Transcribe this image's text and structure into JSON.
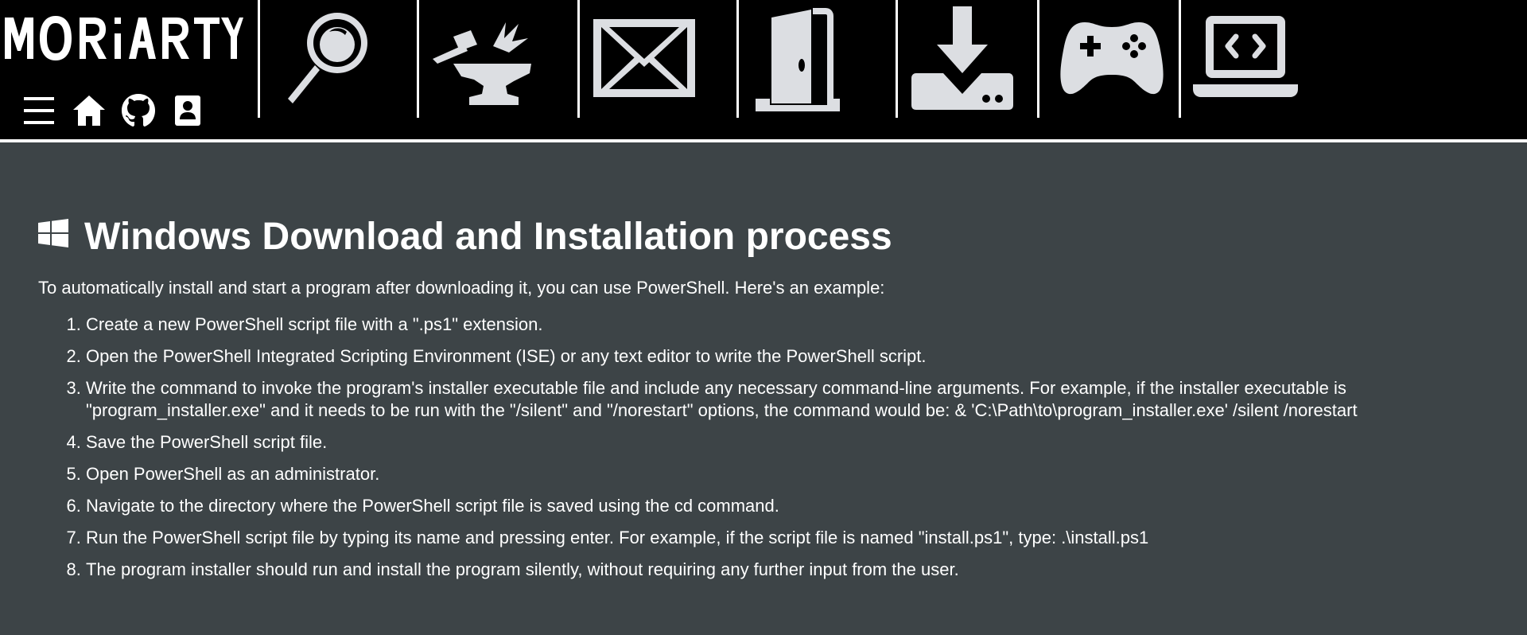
{
  "header": {
    "logo_text": "MORIARTY",
    "mini_nav": [
      {
        "name": "menu-icon"
      },
      {
        "name": "home-icon"
      },
      {
        "name": "github-icon"
      },
      {
        "name": "contact-card-icon"
      }
    ],
    "nav_tiles": [
      {
        "name": "search-icon"
      },
      {
        "name": "anvil-forge-icon"
      },
      {
        "name": "envelope-icon"
      },
      {
        "name": "door-icon"
      },
      {
        "name": "download-icon"
      },
      {
        "name": "gamepad-icon"
      },
      {
        "name": "code-laptop-icon"
      }
    ],
    "colors": {
      "background": "#000000",
      "icon": "#dcdee2",
      "divider": "#ffffff"
    }
  },
  "main": {
    "title_icon": "windows-icon",
    "title": "Windows Download and Installation process",
    "intro": "To automatically install and start a program after downloading it, you can use PowerShell. Here's an example:",
    "steps": [
      "Create a new PowerShell script file with a \".ps1\" extension.",
      "Open the PowerShell Integrated Scripting Environment (ISE) or any text editor to write the PowerShell script.",
      "Write the command to invoke the program's installer executable file and include any necessary command-line arguments. For example, if the installer executable is \"program_installer.exe\" and it needs to be run with the \"/silent\" and \"/norestart\" options, the command would be: & 'C:\\Path\\to\\program_installer.exe' /silent /norestart",
      "Save the PowerShell script file.",
      "Open PowerShell as an administrator.",
      "Navigate to the directory where the PowerShell script file is saved using the cd command.",
      "Run the PowerShell script file by typing its name and pressing enter. For example, if the script file is named \"install.ps1\", type: .\\install.ps1",
      "The program installer should run and install the program silently, without requiring any further input from the user."
    ],
    "colors": {
      "background": "#3d4447",
      "text": "#ffffff"
    }
  }
}
